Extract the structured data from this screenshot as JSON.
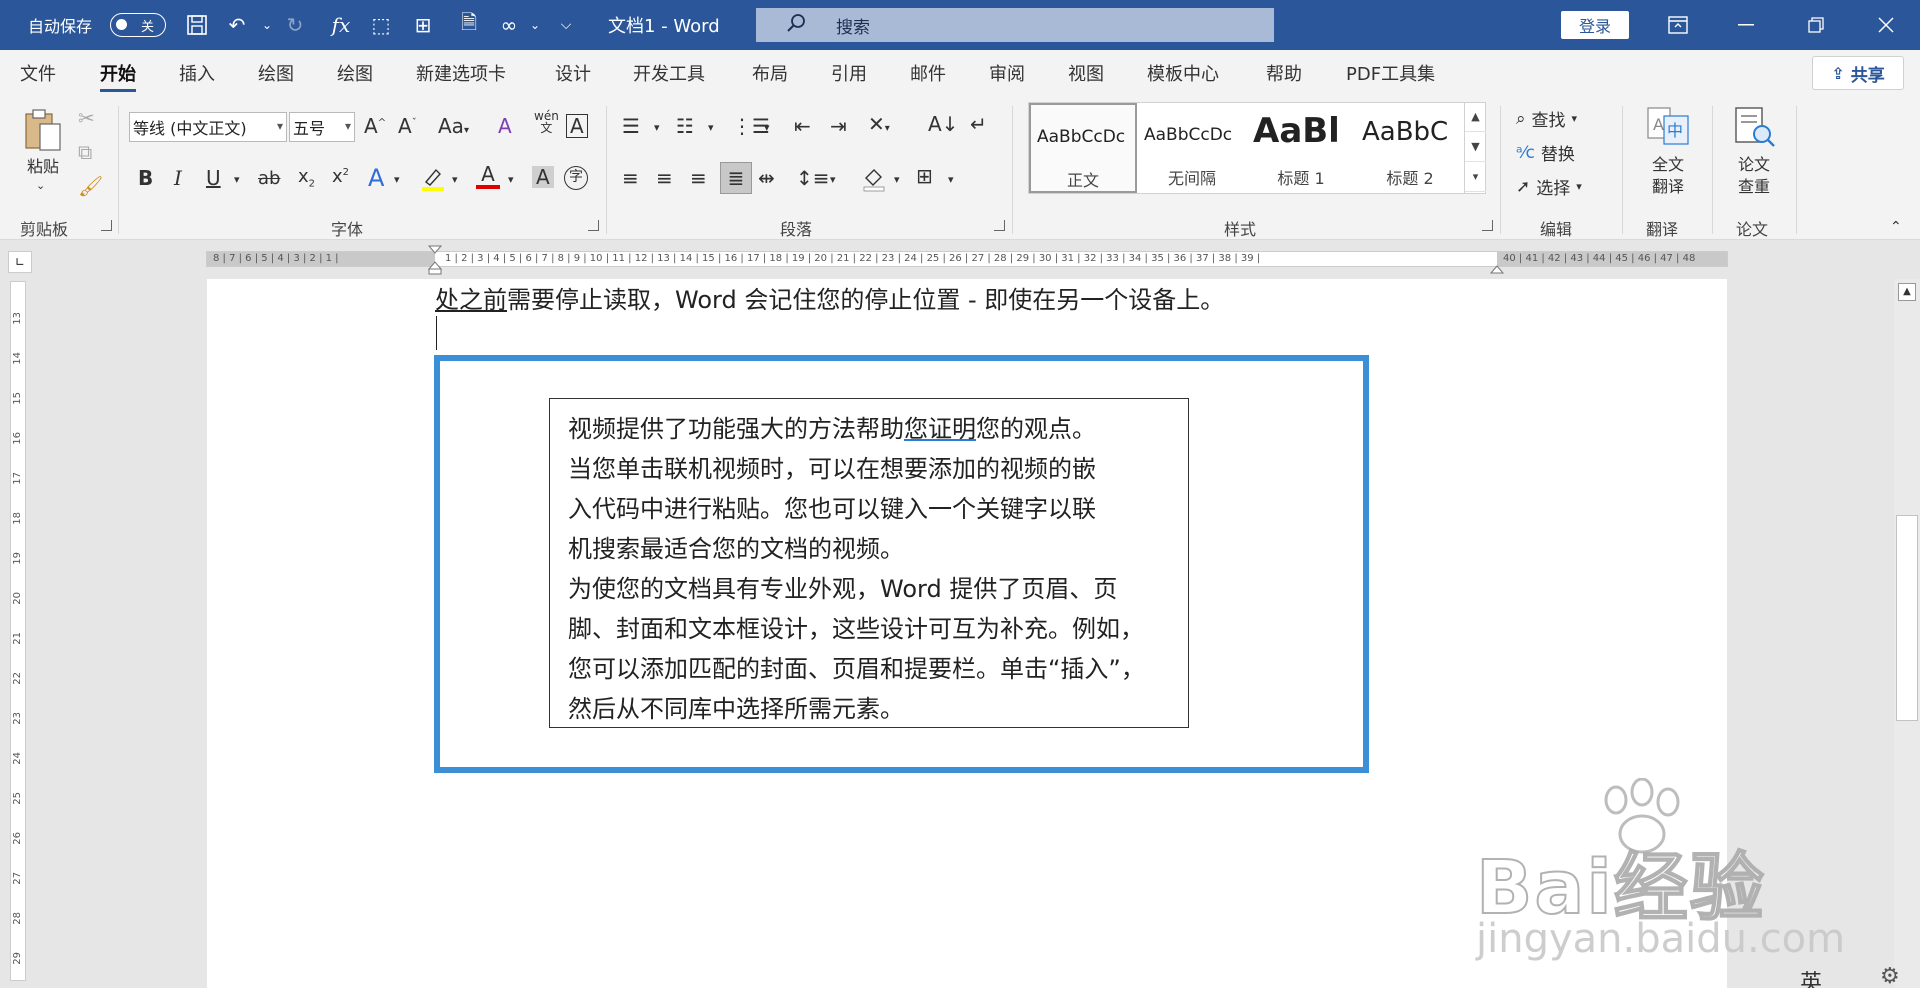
{
  "titlebar": {
    "autosave_label": "自动保存",
    "autosave_state": "关",
    "doc_title": "文档1  -  Word",
    "search_placeholder": "搜索",
    "login_label": "登录"
  },
  "menu": {
    "tabs": [
      "文件",
      "开始",
      "插入",
      "绘图",
      "绘图",
      "新建选项卡",
      "设计",
      "开发工具",
      "布局",
      "引用",
      "邮件",
      "审阅",
      "视图",
      "模板中心",
      "帮助",
      "PDF工具集"
    ],
    "active_tab": "开始",
    "share_label": "共享"
  },
  "ribbon": {
    "clipboard": {
      "paste_label": "粘贴",
      "group_label": "剪贴板"
    },
    "font": {
      "font_name": "等线 (中文正文)",
      "font_size": "五号",
      "group_label": "字体",
      "phonetic_label": "wén"
    },
    "paragraph": {
      "group_label": "段落"
    },
    "styles": {
      "group_label": "样式",
      "items": [
        {
          "sample": "AaBbCcDc",
          "name": "正文"
        },
        {
          "sample": "AaBbCcDc",
          "name": "无间隔"
        },
        {
          "sample": "AaBl",
          "name": "标题 1"
        },
        {
          "sample": "AaBbC",
          "name": "标题 2"
        }
      ]
    },
    "editing": {
      "group_label": "编辑",
      "find_label": "查找",
      "replace_label": "替换",
      "select_label": "选择"
    },
    "translate": {
      "button_line1": "全文",
      "button_line2": "翻译",
      "group_label": "翻译"
    },
    "paper": {
      "button_line1": "论文",
      "button_line2": "查重",
      "group_label": "论文"
    }
  },
  "ruler": {
    "left_numbers": "8 | 7 | 6 | 5 | 4 | 3 | 2 | 1 |",
    "right_numbers": "1 | 2 | 3 | 4 | 5 | 6 | 7 | 8 | 9 | 10 | 11 | 12 | 13 | 14 | 15 | 16 | 17 | 18 | 19 | 20 | 21 | 22 | 23 | 24 | 25 | 26 | 27 | 28 | 29 | 30 | 31 | 32 | 33 | 34 | 35 | 36 | 37 | 38 | 39 |",
    "tail_numbers": "40 | 41 | 42 | 43 | 44 | 45 | 46 | 47 | 48",
    "vertical_numbers": [
      "13",
      "14",
      "15",
      "16",
      "17",
      "18",
      "19",
      "20",
      "21",
      "22",
      "23",
      "24",
      "25",
      "26",
      "27",
      "28",
      "29"
    ]
  },
  "document": {
    "top_line_underlined": "处之前",
    "top_line_rest": "需要停止读取，Word 会记住您的停止位置 - 即使在另一个设备上。",
    "textbox_lines": [
      "视频提供了功能强大的方法帮助您证明您的观点。",
      "当您单击联机视频时，可以在想要添加的视频的嵌",
      "入代码中进行粘贴。您也可以键入一个关键字以联",
      "机搜索最适合您的文档的视频。",
      "为使您的文档具有专业外观，Word 提供了页眉、页",
      "脚、封面和文本框设计，这些设计可互为补充。例如，",
      "您可以添加匹配的封面、页眉和提要栏。单击“插入”，",
      "然后从不同库中选择所需元素。"
    ],
    "first_line_prefix": "视频提供了功能强大的方法帮助",
    "first_line_underlined": "您证明",
    "first_line_suffix": "您的观点。"
  },
  "watermark": {
    "brand": "Bai经验",
    "url": "jingyan.baidu.com"
  },
  "status": {
    "ime_label": "英"
  },
  "colors": {
    "titlebar": "#2b579a",
    "frame": "#3a8fd7"
  }
}
